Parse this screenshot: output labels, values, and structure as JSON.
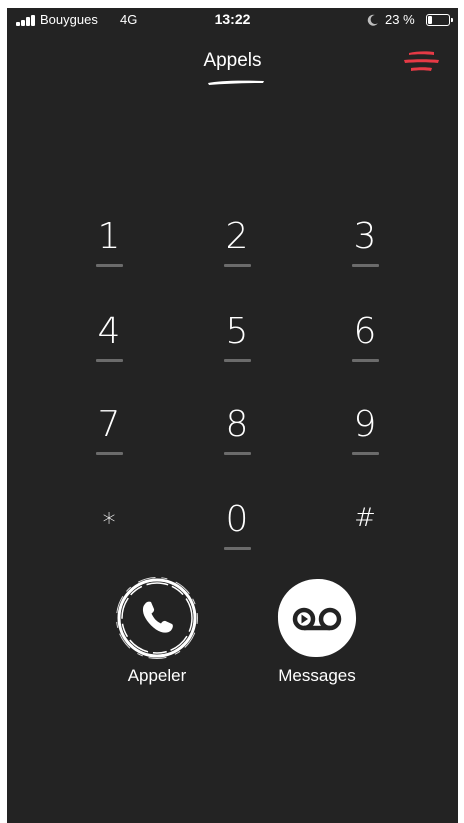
{
  "status_bar": {
    "carrier": "Bouygues",
    "network": "4G",
    "time": "13:22",
    "battery_percent_text": "23 %",
    "battery_level": 0.23,
    "signal_bars": 4,
    "icons": [
      "signal-icon",
      "moon-icon",
      "battery-icon"
    ]
  },
  "header": {
    "title": "Appels",
    "menu_icon": "hamburger-menu-icon",
    "accent_color": "#e63a46"
  },
  "keypad": {
    "keys": [
      {
        "label": "1"
      },
      {
        "label": "2"
      },
      {
        "label": "3"
      },
      {
        "label": "4"
      },
      {
        "label": "5"
      },
      {
        "label": "6"
      },
      {
        "label": "7"
      },
      {
        "label": "8"
      },
      {
        "label": "9"
      },
      {
        "label": "∗"
      },
      {
        "label": "0"
      },
      {
        "label": "#"
      }
    ]
  },
  "actions": {
    "call_label": "Appeler",
    "call_icon": "phone-icon",
    "messages_label": "Messages",
    "messages_icon": "voicemail-icon"
  },
  "colors": {
    "background": "#232323",
    "text": "#ffffff",
    "key_underline": "#6b6b6b"
  }
}
